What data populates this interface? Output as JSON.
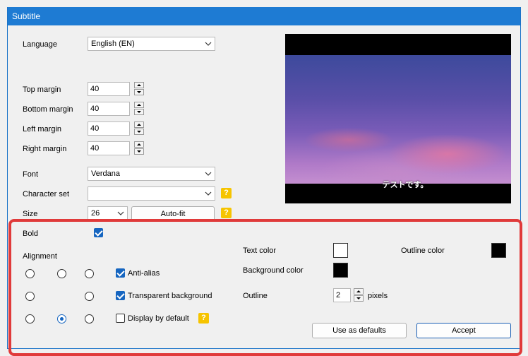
{
  "window": {
    "title": "Subtitle"
  },
  "language": {
    "label": "Language",
    "value": "English (EN)"
  },
  "margins": {
    "top": {
      "label": "Top margin",
      "value": "40"
    },
    "bottom": {
      "label": "Bottom margin",
      "value": "40"
    },
    "left": {
      "label": "Left margin",
      "value": "40"
    },
    "right": {
      "label": "Right margin",
      "value": "40"
    }
  },
  "font": {
    "label": "Font",
    "value": "Verdana"
  },
  "charset": {
    "label": "Character set",
    "value": ""
  },
  "size": {
    "label": "Size",
    "value": "26",
    "autofit": "Auto-fit"
  },
  "help": "?",
  "preview": {
    "subtitle_text": "テストです。"
  },
  "bold": {
    "label": "Bold",
    "checked": true
  },
  "alignment": {
    "label": "Alignment",
    "selected": "bottom-center"
  },
  "anti_alias": {
    "label": "Anti-alias",
    "checked": true
  },
  "transparent_bg": {
    "label": "Transparent background",
    "checked": true
  },
  "display_default": {
    "label": "Display by default",
    "checked": false
  },
  "text_color": {
    "label": "Text color",
    "color": "#ffffff"
  },
  "background_color": {
    "label": "Background color",
    "color": "#000000"
  },
  "outline_color": {
    "label": "Outline color",
    "color": "#000000"
  },
  "outline": {
    "label": "Outline",
    "value": "2",
    "unit": "pixels"
  },
  "buttons": {
    "use_defaults": "Use as defaults",
    "accept": "Accept"
  },
  "colors": {
    "highlight": "#e03a3a",
    "titlebar": "#1e7bd3",
    "accent": "#1565c0"
  }
}
